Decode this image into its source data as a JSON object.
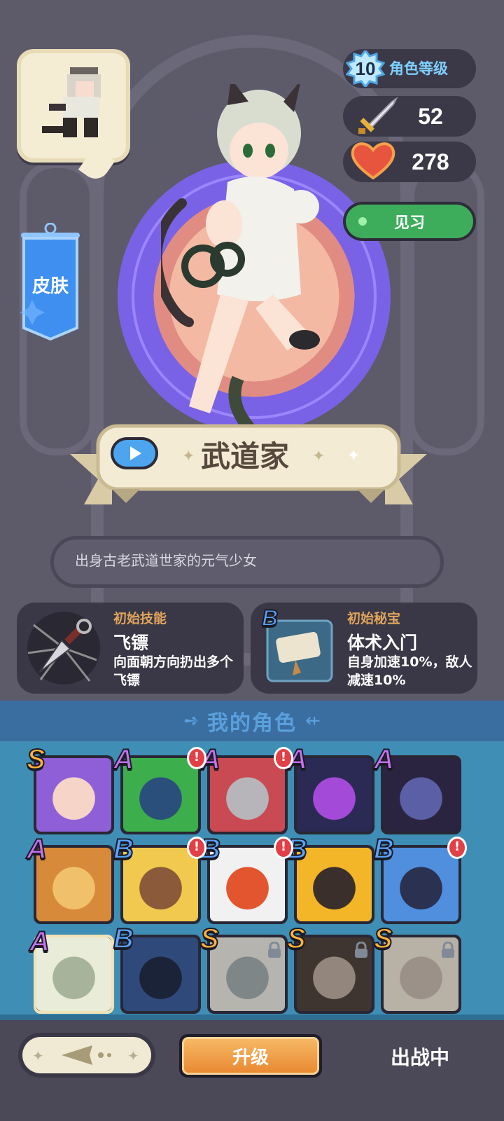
{
  "stats": {
    "level": "10",
    "level_label": "角色等级",
    "attack": "52",
    "hp": "278"
  },
  "buttons": {
    "intern": "见习",
    "skin": "皮肤",
    "upgrade": "升级",
    "deployed": "出战中"
  },
  "character": {
    "name": "武道家",
    "description": "出身古老武道世家的元气少女"
  },
  "skill": {
    "header": "初始技能",
    "name": "飞镖",
    "description": "向面朝方向扔出多个飞镖"
  },
  "treasure": {
    "rank": "B",
    "header": "初始秘宝",
    "name": "体术入门",
    "description": "自身加速10%，敌人减速10%"
  },
  "roles": {
    "title": "我的角色",
    "items": [
      {
        "rank": "S",
        "alert": false,
        "locked": false,
        "selected": false,
        "colors": [
          "#8e5fd6",
          "#f6d4c8"
        ]
      },
      {
        "rank": "A",
        "alert": true,
        "locked": false,
        "selected": false,
        "colors": [
          "#3cae4b",
          "#2a4f7a"
        ]
      },
      {
        "rank": "A",
        "alert": true,
        "locked": false,
        "selected": false,
        "colors": [
          "#c94a52",
          "#b7b5ba"
        ]
      },
      {
        "rank": "A",
        "alert": false,
        "locked": false,
        "selected": false,
        "colors": [
          "#2b2a55",
          "#a34bd8"
        ]
      },
      {
        "rank": "A",
        "alert": false,
        "locked": false,
        "selected": false,
        "colors": [
          "#2a2440",
          "#5b5fa6"
        ]
      },
      {
        "rank": "A",
        "alert": false,
        "locked": false,
        "selected": false,
        "colors": [
          "#d68a3a",
          "#f0c16a"
        ]
      },
      {
        "rank": "B",
        "alert": true,
        "locked": false,
        "selected": false,
        "colors": [
          "#f0c94e",
          "#8a5a3a"
        ]
      },
      {
        "rank": "B",
        "alert": true,
        "locked": false,
        "selected": false,
        "colors": [
          "#f1f1f1",
          "#e2552e"
        ]
      },
      {
        "rank": "B",
        "alert": false,
        "locked": false,
        "selected": false,
        "colors": [
          "#f2b628",
          "#3a2f2a"
        ]
      },
      {
        "rank": "B",
        "alert": true,
        "locked": false,
        "selected": false,
        "colors": [
          "#4f8fde",
          "#2b3150"
        ]
      },
      {
        "rank": "A",
        "alert": false,
        "locked": false,
        "selected": true,
        "colors": [
          "#e9ecd8",
          "#a7b39a"
        ]
      },
      {
        "rank": "B",
        "alert": false,
        "locked": false,
        "selected": false,
        "colors": [
          "#2f4a7a",
          "#1b2338"
        ]
      },
      {
        "rank": "S",
        "alert": false,
        "locked": true,
        "selected": false,
        "colors": [
          "#d9d4c4",
          "#8aa0a8"
        ]
      },
      {
        "rank": "S",
        "alert": false,
        "locked": true,
        "selected": false,
        "colors": [
          "#5a3a2c",
          "#c59a7a"
        ]
      },
      {
        "rank": "S",
        "alert": false,
        "locked": true,
        "selected": false,
        "colors": [
          "#e6cfa8",
          "#c9a88a"
        ]
      }
    ]
  },
  "colors": {
    "rank_S": "#ffb23c",
    "rank_A": "#c571f0",
    "rank_B": "#5aa2ff",
    "accent_green": "#3dad5c",
    "accent_orange": "#e98a32"
  },
  "icons": {
    "level": "level-star-badge-icon",
    "attack": "sword-icon",
    "hp": "heart-icon",
    "play": "play-icon",
    "skill": "kunai-icon",
    "treasure": "scroll-icon",
    "lock": "lock-icon",
    "alert": "exclamation-icon"
  }
}
